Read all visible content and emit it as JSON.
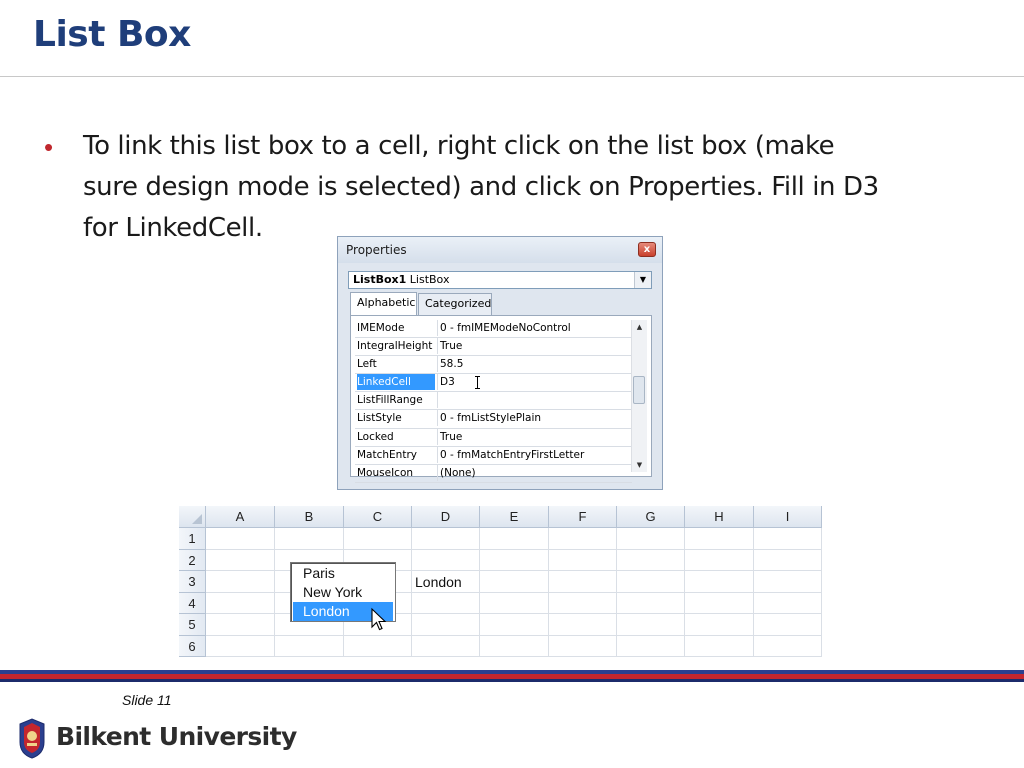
{
  "slide": {
    "title": "List Box",
    "bullet_lines": [
      "To link this list box to a cell, right click on the list box (make",
      "sure design mode is selected) and click on Properties. Fill in D3",
      "for LinkedCell."
    ]
  },
  "properties": {
    "window_title": "Properties",
    "close_glyph": "x",
    "object_name": "ListBox1",
    "object_type": "ListBox",
    "tabs": [
      "Alphabetic",
      "Categorized"
    ],
    "active_tab": "Alphabetic",
    "rows": [
      {
        "name": "IMEMode",
        "value": "0 - fmIMEModeNoControl"
      },
      {
        "name": "IntegralHeight",
        "value": "True"
      },
      {
        "name": "Left",
        "value": "58.5"
      },
      {
        "name": "LinkedCell",
        "value": "D3"
      },
      {
        "name": "ListFillRange",
        "value": ""
      },
      {
        "name": "ListStyle",
        "value": "0 - fmListStylePlain"
      },
      {
        "name": "Locked",
        "value": "True"
      },
      {
        "name": "MatchEntry",
        "value": "0 - fmMatchEntryFirstLetter"
      },
      {
        "name": "MouseIcon",
        "value": "(None)"
      }
    ],
    "selected_property": "LinkedCell",
    "selection_color": "#3399ff"
  },
  "spreadsheet": {
    "columns": [
      "A",
      "B",
      "C",
      "D",
      "E",
      "F",
      "G",
      "H",
      "I"
    ],
    "rows": [
      "1",
      "2",
      "3",
      "4",
      "5",
      "6"
    ],
    "d3_value": "London",
    "listbox_items": [
      "Paris",
      "New York",
      "London"
    ],
    "listbox_selected": "London"
  },
  "footer": {
    "slide_label": "Slide 11",
    "university": "Bilkent University",
    "colors": {
      "blue": "#2b3f8f",
      "red": "#c4262e"
    }
  },
  "icons": [
    "close-icon",
    "dropdown-arrow-icon",
    "scroll-up-icon",
    "scroll-down-icon",
    "text-cursor-icon",
    "mouse-pointer-icon",
    "university-logo-icon"
  ]
}
